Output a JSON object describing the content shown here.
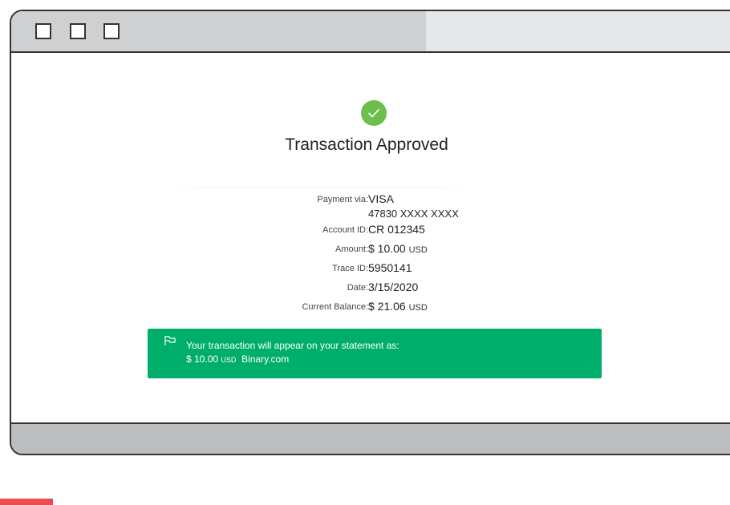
{
  "window": {
    "buttons": [
      "window-button-1",
      "window-button-2",
      "window-button-3"
    ]
  },
  "status": {
    "icon": "checkmark-icon",
    "title": "Transaction Approved",
    "color": "#6dbf4b"
  },
  "details": {
    "payment_label": "Payment via:",
    "payment_value": "VISA",
    "card_number": "47830 XXXX XXXX",
    "account_label": "Account ID:",
    "account_value": "CR 012345",
    "amount_label": "Amount:",
    "amount_value": "$ 10.00",
    "amount_unit": "USD",
    "trace_label": "Trace ID:",
    "trace_value": "5950141",
    "date_label": "Date:",
    "date_value": "3/15/2020",
    "balance_label": "Current Balance:",
    "balance_value": "$ 21.06",
    "balance_unit": "USD"
  },
  "banner": {
    "icon": "flag-icon",
    "line1": "Your transaction will appear on your statement as:",
    "amount": "$ 10.00",
    "unit": "USD",
    "merchant": "Binary.com",
    "color": "#00ae6c"
  }
}
